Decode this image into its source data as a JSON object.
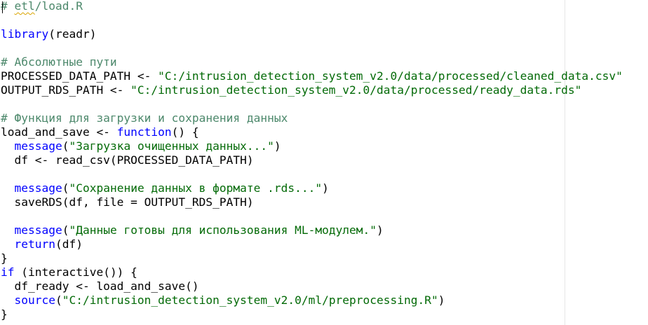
{
  "editor": {
    "lines": [
      {
        "segments": [
          {
            "type": "cm",
            "text": "# "
          },
          {
            "type": "cm-sq",
            "text": "etl"
          },
          {
            "type": "cm",
            "text": "/load.R"
          }
        ]
      },
      {
        "segments": []
      },
      {
        "segments": [
          {
            "type": "fn",
            "text": "library"
          },
          {
            "type": "tx",
            "text": "(readr)"
          }
        ]
      },
      {
        "segments": []
      },
      {
        "segments": [
          {
            "type": "cm",
            "text": "# Абсолютные пути"
          }
        ]
      },
      {
        "segments": [
          {
            "type": "tx",
            "text": "PROCESSED_DATA_PATH <- "
          },
          {
            "type": "st",
            "text": "\"C:/intrusion_detection_system_v2.0/data/processed/cleaned_data.csv\""
          }
        ]
      },
      {
        "segments": [
          {
            "type": "tx",
            "text": "OUTPUT_RDS_PATH <- "
          },
          {
            "type": "st",
            "text": "\"C:/intrusion_detection_system_v2.0/data/processed/ready_data.rds\""
          }
        ]
      },
      {
        "segments": []
      },
      {
        "segments": [
          {
            "type": "cm",
            "text": "# Функция для загрузки и сохранения данных"
          }
        ]
      },
      {
        "segments": [
          {
            "type": "tx",
            "text": "load_and_save <- "
          },
          {
            "type": "kw",
            "text": "function"
          },
          {
            "type": "tx",
            "text": "() {"
          }
        ]
      },
      {
        "segments": [
          {
            "type": "tx",
            "text": "  "
          },
          {
            "type": "fn",
            "text": "message"
          },
          {
            "type": "tx",
            "text": "("
          },
          {
            "type": "st",
            "text": "\"Загрузка очищенных данных...\""
          },
          {
            "type": "tx",
            "text": ")"
          }
        ]
      },
      {
        "segments": [
          {
            "type": "tx",
            "text": "  df <- read_csv(PROCESSED_DATA_PATH)"
          }
        ]
      },
      {
        "segments": []
      },
      {
        "segments": [
          {
            "type": "tx",
            "text": "  "
          },
          {
            "type": "fn",
            "text": "message"
          },
          {
            "type": "tx",
            "text": "("
          },
          {
            "type": "st",
            "text": "\"Сохранение данных в формате .rds...\""
          },
          {
            "type": "tx",
            "text": ")"
          }
        ]
      },
      {
        "segments": [
          {
            "type": "tx",
            "text": "  saveRDS(df, file = OUTPUT_RDS_PATH)"
          }
        ]
      },
      {
        "segments": []
      },
      {
        "segments": [
          {
            "type": "tx",
            "text": "  "
          },
          {
            "type": "fn",
            "text": "message"
          },
          {
            "type": "tx",
            "text": "("
          },
          {
            "type": "st",
            "text": "\"Данные готовы для использования ML-модулем.\""
          },
          {
            "type": "tx",
            "text": ")"
          }
        ]
      },
      {
        "segments": [
          {
            "type": "tx",
            "text": "  "
          },
          {
            "type": "kw",
            "text": "return"
          },
          {
            "type": "tx",
            "text": "(df)"
          }
        ]
      },
      {
        "segments": [
          {
            "type": "tx",
            "text": "}"
          }
        ]
      },
      {
        "segments": [
          {
            "type": "kw",
            "text": "if"
          },
          {
            "type": "tx",
            "text": " (interactive()) {"
          }
        ]
      },
      {
        "segments": [
          {
            "type": "tx",
            "text": "  df_ready <- load_and_save()"
          }
        ]
      },
      {
        "segments": [
          {
            "type": "tx",
            "text": "  "
          },
          {
            "type": "fn",
            "text": "source"
          },
          {
            "type": "tx",
            "text": "("
          },
          {
            "type": "st",
            "text": "\"C:/intrusion_detection_system_v2.0/ml/preprocessing.R\""
          },
          {
            "type": "tx",
            "text": ")"
          }
        ]
      },
      {
        "segments": [
          {
            "type": "tx",
            "text": "}"
          }
        ]
      }
    ]
  },
  "colors": {
    "comment": "#4c886b",
    "keyword": "#0000ff",
    "string": "#036a07",
    "text": "#000000",
    "background": "#ffffff"
  }
}
